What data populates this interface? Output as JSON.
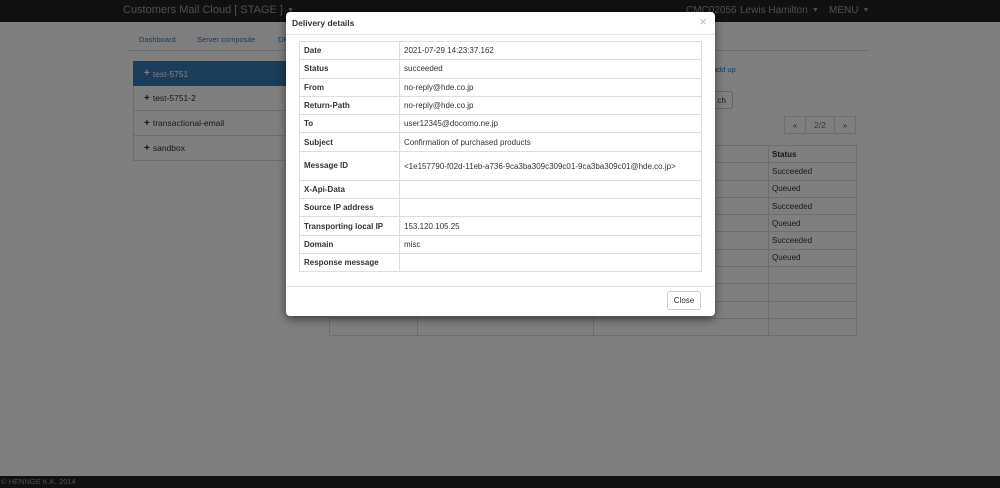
{
  "navbar": {
    "brand": "Customers Mail Cloud [ STAGE ]",
    "account_id": "CMC02056",
    "user": "Lewis Hamilton",
    "menu": "MENU"
  },
  "subnav": [
    "Dashboard",
    "Server composite",
    "DK"
  ],
  "sidebar": [
    "test-5751",
    "test-5751-2",
    "transactional-email",
    "sandbox"
  ],
  "background": {
    "add_up_link": "y add up",
    "search_button": "ch",
    "pager": {
      "prev": "«",
      "current": "2/2",
      "next": "»"
    },
    "status_header": "Status",
    "statuses": [
      "Succeeded",
      "Queued",
      "Succeeded",
      "Queued",
      "Succeeded",
      "Queued"
    ]
  },
  "modal": {
    "title": "Delivery details",
    "close_icon": "×",
    "close_button": "Close",
    "rows": [
      {
        "label": "Date",
        "value": "2021-07-29 14:23:37.162"
      },
      {
        "label": "Status",
        "value": "succeeded"
      },
      {
        "label": "From",
        "value": "no-reply@hde.co.jp"
      },
      {
        "label": "Return-Path",
        "value": "no-reply@hde.co.jp"
      },
      {
        "label": "To",
        "value": "user12345@docomo.ne.jp"
      },
      {
        "label": "Subject",
        "value": "Confirmation of purchased products"
      },
      {
        "label": "Message ID",
        "value": "<1e157790-f02d-11eb-a736-9ca3ba309c309c01-9ca3ba309c01@hde.co.jp>"
      },
      {
        "label": "X-Api-Data",
        "value": ""
      },
      {
        "label": "Source IP address",
        "value": ""
      },
      {
        "label": "Transporting local IP",
        "value": "153.120.105.25"
      },
      {
        "label": "Domain",
        "value": "misc"
      },
      {
        "label": "Response message",
        "value": ""
      }
    ]
  },
  "footer": "© HENNGE K.K. 2014"
}
